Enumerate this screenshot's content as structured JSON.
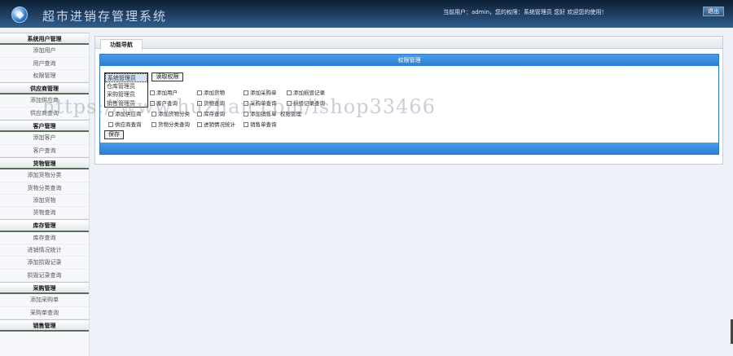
{
  "header": {
    "app_title": "超市进销存管理系统",
    "user_info": "当前用户：admin，您的权限：系统管理员 您好 欢迎您的使用！",
    "logout_label": "退出"
  },
  "sidebar": {
    "groups": [
      {
        "title": "系统用户管理",
        "items": [
          "添加用户",
          "用户查询",
          "权限管理"
        ]
      },
      {
        "title": "供应商管理",
        "items": [
          "添加供应商",
          "供应商查询"
        ]
      },
      {
        "title": "客户管理",
        "items": [
          "添加客户",
          "客户查询"
        ]
      },
      {
        "title": "货物管理",
        "items": [
          "添加货物分类",
          "货物分类查询",
          "添加货物",
          "货物查询"
        ]
      },
      {
        "title": "库存管理",
        "items": [
          "库存查询",
          "进销情况统计",
          "添加损毁记录",
          "损毁记录查询"
        ]
      },
      {
        "title": "采购管理",
        "items": [
          "添加采购单",
          "采购单查询"
        ]
      },
      {
        "title": "销售管理",
        "items": []
      }
    ]
  },
  "main": {
    "tab_label": "功能导航",
    "panel_title": "权限管理",
    "roles": [
      "系统管理员",
      "仓库管理员",
      "采购管理员",
      "销售管理员"
    ],
    "selected_role_index": 0,
    "read_button_label": "读取权限",
    "save_button_label": "保存",
    "permissions": [
      "添加用户",
      "添加货物",
      "添加采购单",
      "添加损毁记录",
      "客户查询",
      "货物查询",
      "采购单查询",
      "损毁记录查询",
      "添加供应商",
      "添加货物分类",
      "库存查询",
      "添加销售单",
      "权限管理",
      "供应商查询",
      "货物分类查询",
      "进销情况统计",
      "销售单查询"
    ]
  },
  "watermark_text": "https://www.huzhan.com/ishop33466"
}
